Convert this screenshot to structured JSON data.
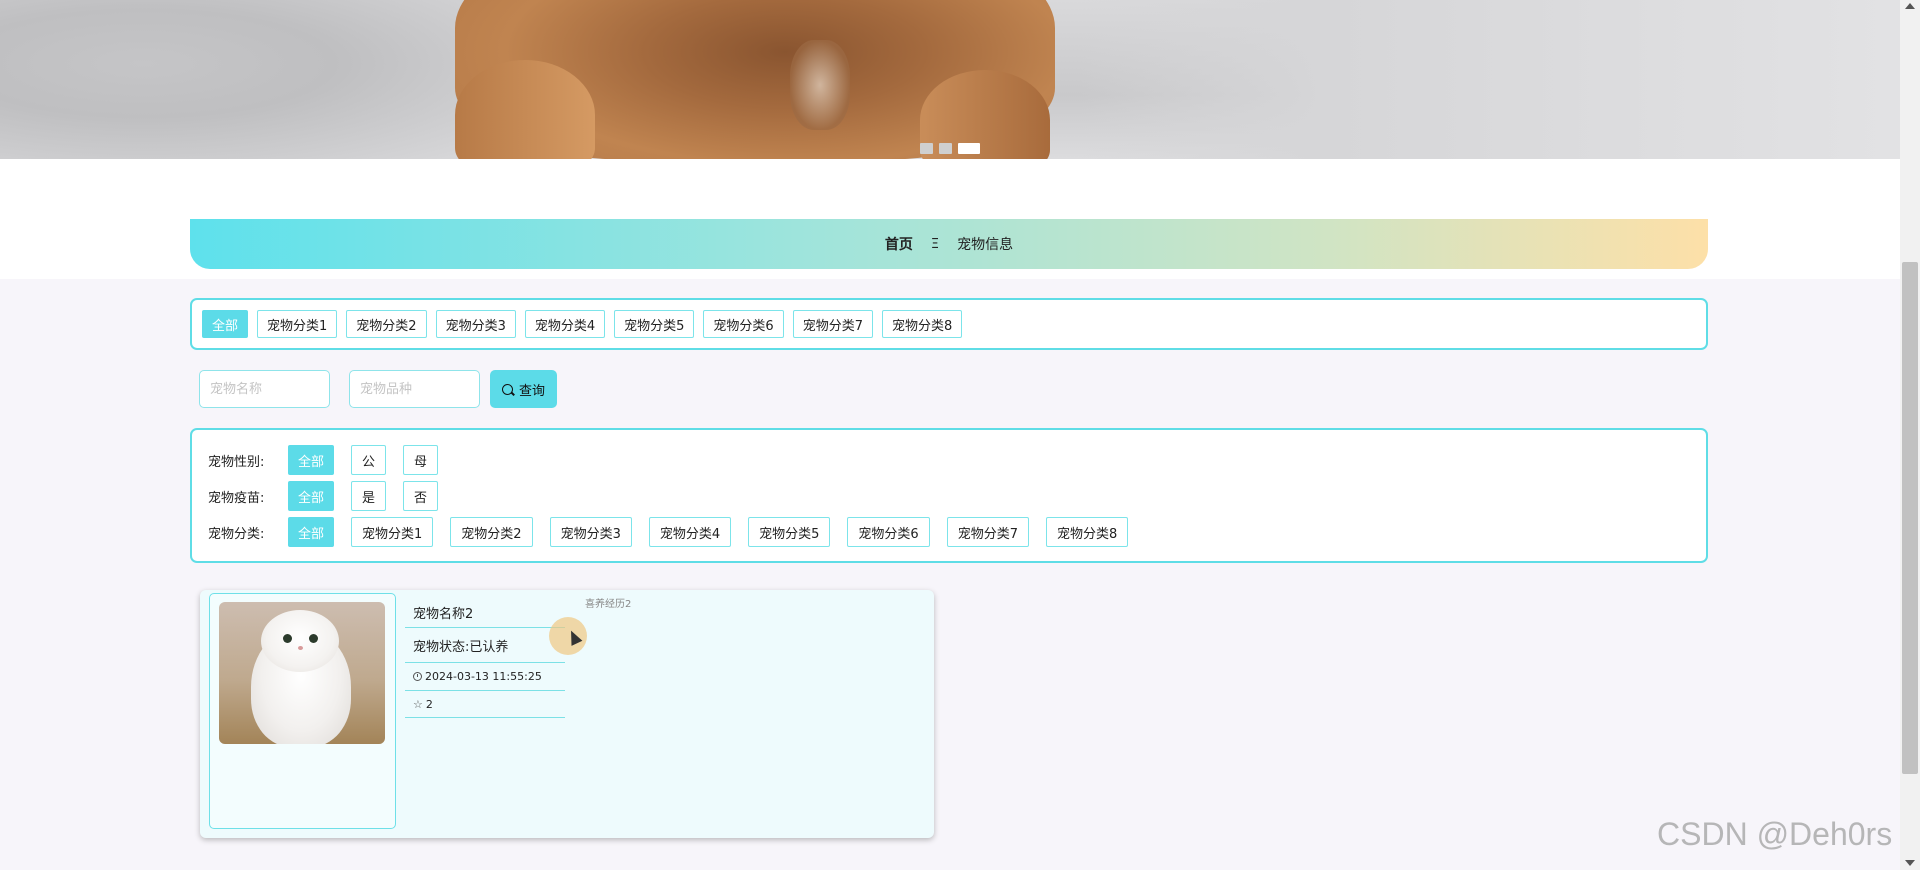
{
  "breadcrumb": {
    "home": "首页",
    "separator": "Ξ",
    "current": "宠物信息"
  },
  "categories": [
    "全部",
    "宠物分类1",
    "宠物分类2",
    "宠物分类3",
    "宠物分类4",
    "宠物分类5",
    "宠物分类6",
    "宠物分类7",
    "宠物分类8"
  ],
  "search": {
    "name_placeholder": "宠物名称",
    "breed_placeholder": "宠物品种",
    "button_label": "查询"
  },
  "filters": {
    "gender": {
      "label": "宠物性别:",
      "options": [
        "全部",
        "公",
        "母"
      ]
    },
    "vaccine": {
      "label": "宠物疫苗:",
      "options": [
        "全部",
        "是",
        "否"
      ]
    },
    "category": {
      "label": "宠物分类:",
      "options": [
        "全部",
        "宠物分类1",
        "宠物分类2",
        "宠物分类3",
        "宠物分类4",
        "宠物分类5",
        "宠物分类6",
        "宠物分类7",
        "宠物分类8"
      ]
    }
  },
  "pet_card": {
    "name": "宠物名称2",
    "status": "宠物状态:已认养",
    "time": "2024-03-13 11:55:25",
    "favorites": "2",
    "experience": "喜养经历2"
  },
  "watermark": "CSDN @Deh0rs",
  "colors": {
    "accent": "#5cdbe8",
    "border": "#5fdde6",
    "gradient_end": "#fde0a8"
  }
}
